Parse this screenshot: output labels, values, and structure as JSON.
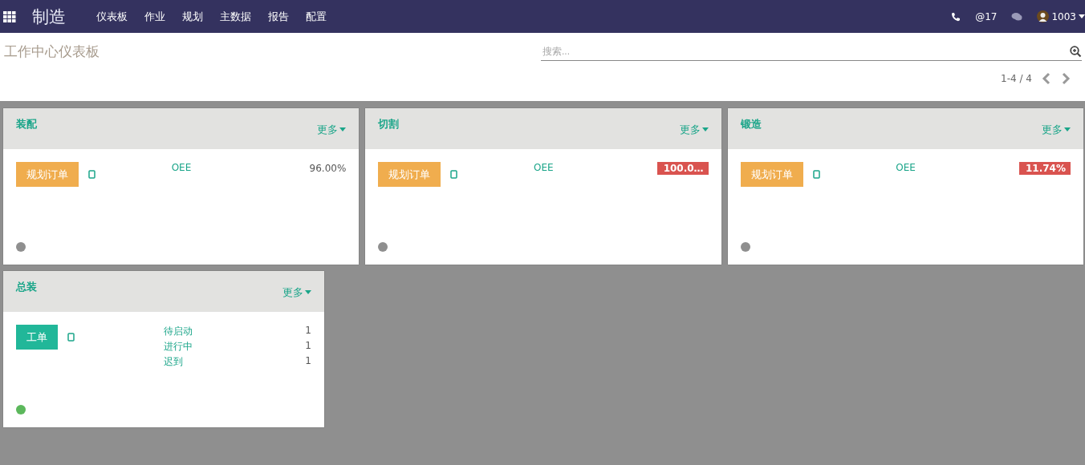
{
  "navbar": {
    "app_title": "制造",
    "menu": [
      {
        "label": "仪表板"
      },
      {
        "label": "作业"
      },
      {
        "label": "规划"
      },
      {
        "label": "主数据"
      },
      {
        "label": "报告"
      },
      {
        "label": "配置"
      }
    ],
    "mentions": "@17",
    "user": "1003"
  },
  "control_panel": {
    "title": "工作中心仪表板",
    "search": {
      "placeholder": "搜索..."
    },
    "pager": "1-4 / 4"
  },
  "cards": [
    {
      "kind": "oee",
      "title": "装配",
      "more": "更多",
      "button": "规划订单",
      "metric_label": "OEE",
      "metric_value": "96.00%",
      "alert": false,
      "color": "#8f8f8f"
    },
    {
      "kind": "oee",
      "title": "切割",
      "more": "更多",
      "button": "规划订单",
      "metric_label": "OEE",
      "metric_value": "100.0…",
      "alert": true,
      "color": "#8f8f8f"
    },
    {
      "kind": "oee",
      "title": "锻造",
      "more": "更多",
      "button": "规划订单",
      "metric_label": "OEE",
      "metric_value": "11.74%",
      "alert": true,
      "color": "#8f8f8f"
    },
    {
      "kind": "orders",
      "title": "总装",
      "more": "更多",
      "button": "工单",
      "counts": [
        {
          "label": "待启动",
          "value": "1"
        },
        {
          "label": "进行中",
          "value": "1"
        },
        {
          "label": "迟到",
          "value": "1"
        }
      ],
      "color": "#5cb85c"
    }
  ]
}
